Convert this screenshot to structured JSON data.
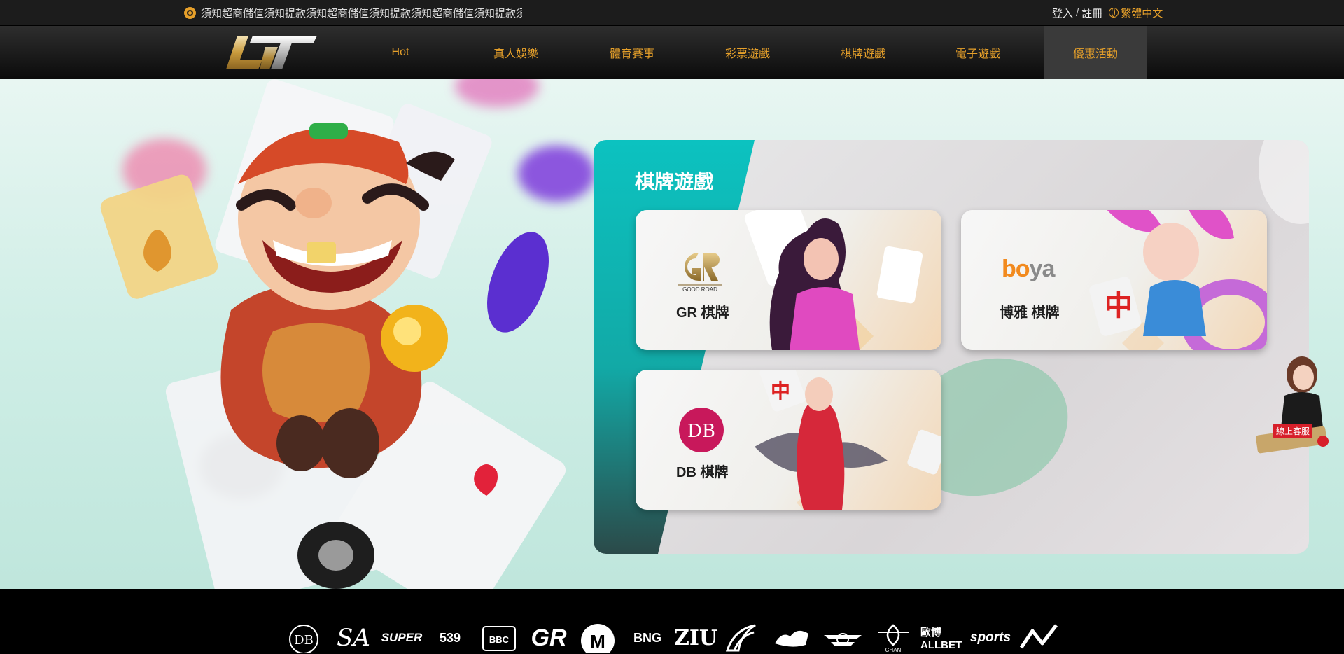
{
  "topbar": {
    "marquee_text": "須知超商儲值須知提款須知超商儲值須知提款須知超商儲值須知提款須",
    "login_label": "登入",
    "separator": "/",
    "register_label": "註冊",
    "language_label": "繁體中文"
  },
  "nav": {
    "items": [
      {
        "label": "Hot"
      },
      {
        "label": "真人娛樂"
      },
      {
        "label": "體育賽事"
      },
      {
        "label": "彩票遊戲"
      },
      {
        "label": "棋牌遊戲"
      },
      {
        "label": "電子遊戲"
      },
      {
        "label": "優惠活動"
      }
    ],
    "active_label": "優惠活動"
  },
  "panel": {
    "title": "棋牌遊戲",
    "cards": [
      {
        "label": "GR 棋牌",
        "logo_text": "GOOD ROAD"
      },
      {
        "label": "博雅 棋牌",
        "logo_text": "boya"
      },
      {
        "label": "DB 棋牌",
        "logo_text": "DB"
      }
    ]
  },
  "service": {
    "label": "線上客服"
  },
  "footer": {
    "providers": [
      "DB",
      "SA",
      "SUPER",
      "539",
      "BBC",
      "GR",
      "M",
      "BNG",
      "ZIU",
      "",
      "",
      "",
      "CHAN",
      "歐博ALLBET",
      "sports",
      ""
    ]
  },
  "colors": {
    "accent_gold": "#e6a02a",
    "teal": "#0bbfbd",
    "service_red": "#d71f2a",
    "nav_active": "#3a3a3a"
  }
}
